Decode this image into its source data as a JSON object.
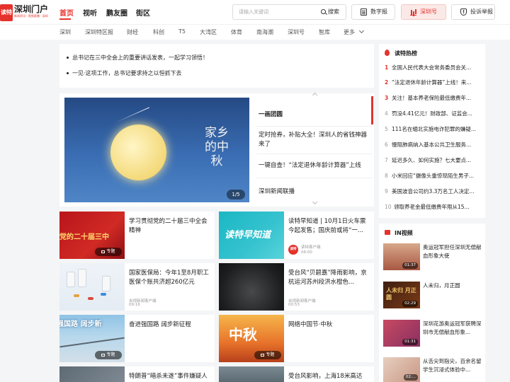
{
  "logo": {
    "mark": "读特",
    "text": "深圳门户",
    "sub": "新闻资讯 · 视频直播 · 深圳"
  },
  "topnav": [
    "首页",
    "视听",
    "鹏友圈",
    "街区"
  ],
  "search": {
    "placeholder": "请输入关键词",
    "button": "搜索"
  },
  "toolbar": {
    "digital_paper": "数字报",
    "shenzhen_hao": "深圳号",
    "report": "投诉举报"
  },
  "subnav": [
    "深圳",
    "深圳特区报",
    "财经",
    "科创",
    "T5",
    "大湾区",
    "体育",
    "南海潮",
    "深圳号",
    "智库",
    "更多"
  ],
  "notice": [
    "总书记在三中全会上的重要讲话发表，一起学习领悟！",
    "一见·这项工作，总书记要求持之以恒抓下去"
  ],
  "feature": {
    "calligraphy": "家乡的中秋",
    "pager": "1/5",
    "items": [
      "一画团圆",
      "定时抢券，补贴大全！深圳人的省钱神器来了",
      "一键自查！“法定退休年龄计算器”上线",
      "深圳新闻联播"
    ]
  },
  "cards": [
    {
      "title": "学习贯彻党的二十届三中全会精神",
      "badge": "专题",
      "thumb_text": "彻党的二十届三中"
    },
    {
      "title": "读特早知道 | 10月1日火车票今起发售；国庆前或将“一...",
      "source": "读特客户端",
      "time": "06:00",
      "avatar": "读特",
      "thumb_text": "读特早知道"
    },
    {
      "title": "国家医保局：今年1至8月职工医保个账共济超260亿元",
      "source": "央视新闻客户端",
      "time": "09:16"
    },
    {
      "title": "受台风“贝碧嘉”降雨影响，京杭运河苏州段洪水橙色...",
      "source": "央视新闻客户端",
      "time": "00:53"
    },
    {
      "title": "奋进强国路 阔步新征程",
      "badge": "专题",
      "thumb_text": "强国路 阔步新"
    },
    {
      "title": "网络中国节·中秋",
      "badge": "专题",
      "thumb_text": "中秋"
    },
    {
      "title": "特朗普“暗杀未遂”事件嫌疑人"
    },
    {
      "title": "受台风影响，上海18米高达"
    }
  ],
  "hot": {
    "title": "读特热榜",
    "items": [
      {
        "rank": "1",
        "text": "全国人民代表大会常务委员会关..."
      },
      {
        "rank": "2",
        "text": "“法定退休年龄计算器”上线！来..."
      },
      {
        "rank": "3",
        "text": "关注！基本养老保险最低缴费年..."
      },
      {
        "rank": "4",
        "text": "罚没4.41亿元！财政部、证监会..."
      },
      {
        "rank": "5",
        "text": "111名在缅北实施电诈犯罪的嫌疑..."
      },
      {
        "rank": "6",
        "text": "慢阻肺病纳入基本公共卫生服务..."
      },
      {
        "rank": "7",
        "text": "延迟多久、如何实施？七大要点..."
      },
      {
        "rank": "8",
        "text": "小米回应“摄像头重惊现陌生男子..."
      },
      {
        "rank": "9",
        "text": "美国波音公司约3.3万名工人决定..."
      },
      {
        "rank": "10",
        "text": "领取养老金最低缴费年限从15..."
      }
    ]
  },
  "video": {
    "title": "IN视频",
    "items": [
      {
        "title": "奥运冠军担任深圳无偿献血形象大使",
        "duration": "01:37"
      },
      {
        "title": "人未归，月正圆",
        "duration": "02:29",
        "thumb_text": "人未归 月正圆"
      },
      {
        "title": "深圳花游奥运冠军获聘深圳市无偿献血形象...",
        "duration": "01:31"
      },
      {
        "title": "从舌尖到指尖，百余名留学生沉浸式体验中...",
        "duration": "02:..."
      }
    ]
  },
  "colors": {
    "brand": "#e6322c",
    "accent_bg": "#fbe9e7"
  }
}
